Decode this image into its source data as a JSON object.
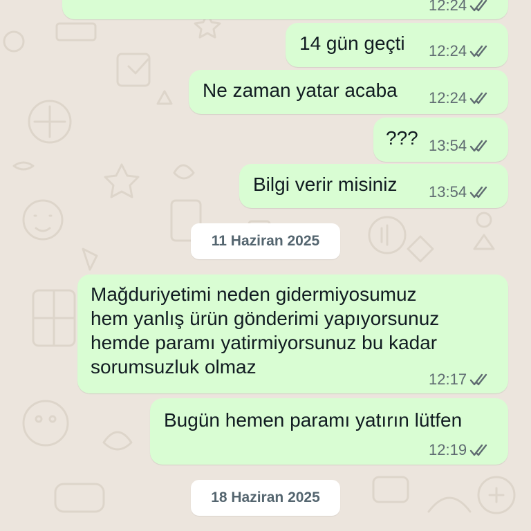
{
  "chat": {
    "messages": [
      {
        "text": "",
        "time": "12:24",
        "status": "read"
      },
      {
        "text": "14 gün geçti",
        "time": "12:24",
        "status": "read"
      },
      {
        "text": "Ne zaman yatar acaba",
        "time": "12:24",
        "status": "read"
      },
      {
        "text": "???",
        "time": "13:54",
        "status": "read"
      },
      {
        "text": "Bilgi verir misiniz",
        "time": "13:54",
        "status": "read"
      },
      {
        "text": "Mağduriyetimi neden gidermiyosumuz\nhem yanlış ürün gönderimi yapıyorsunuz\nhemde paramı yatirmiyorsunuz bu kadar\nsorumsuzluk olmaz",
        "time": "12:17",
        "status": "read"
      },
      {
        "text": "Bugün hemen paramı yatırın lütfen",
        "time": "12:19",
        "status": "read"
      }
    ],
    "date_separators": [
      "11 Haziran 2025",
      "18 Haziran 2025"
    ]
  },
  "colors": {
    "outgoing_bubble": "#d9fdd3",
    "wallpaper": "#ece5dd",
    "read_ticks": "#5f6b71",
    "date_pill": "#ffffff"
  },
  "icons": {
    "read_receipt": "double-check-icon",
    "wallpaper": "doodle-pattern"
  }
}
